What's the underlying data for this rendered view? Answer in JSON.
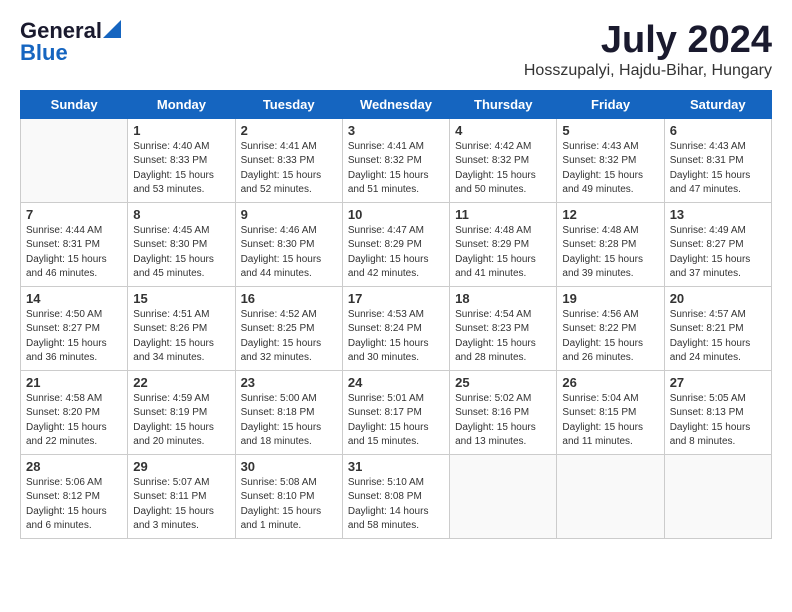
{
  "logo": {
    "general": "General",
    "blue": "Blue"
  },
  "title": "July 2024",
  "subtitle": "Hosszupalyi, Hajdu-Bihar, Hungary",
  "days_header": [
    "Sunday",
    "Monday",
    "Tuesday",
    "Wednesday",
    "Thursday",
    "Friday",
    "Saturday"
  ],
  "weeks": [
    [
      {
        "day": "",
        "info": ""
      },
      {
        "day": "1",
        "info": "Sunrise: 4:40 AM\nSunset: 8:33 PM\nDaylight: 15 hours\nand 53 minutes."
      },
      {
        "day": "2",
        "info": "Sunrise: 4:41 AM\nSunset: 8:33 PM\nDaylight: 15 hours\nand 52 minutes."
      },
      {
        "day": "3",
        "info": "Sunrise: 4:41 AM\nSunset: 8:32 PM\nDaylight: 15 hours\nand 51 minutes."
      },
      {
        "day": "4",
        "info": "Sunrise: 4:42 AM\nSunset: 8:32 PM\nDaylight: 15 hours\nand 50 minutes."
      },
      {
        "day": "5",
        "info": "Sunrise: 4:43 AM\nSunset: 8:32 PM\nDaylight: 15 hours\nand 49 minutes."
      },
      {
        "day": "6",
        "info": "Sunrise: 4:43 AM\nSunset: 8:31 PM\nDaylight: 15 hours\nand 47 minutes."
      }
    ],
    [
      {
        "day": "7",
        "info": "Sunrise: 4:44 AM\nSunset: 8:31 PM\nDaylight: 15 hours\nand 46 minutes."
      },
      {
        "day": "8",
        "info": "Sunrise: 4:45 AM\nSunset: 8:30 PM\nDaylight: 15 hours\nand 45 minutes."
      },
      {
        "day": "9",
        "info": "Sunrise: 4:46 AM\nSunset: 8:30 PM\nDaylight: 15 hours\nand 44 minutes."
      },
      {
        "day": "10",
        "info": "Sunrise: 4:47 AM\nSunset: 8:29 PM\nDaylight: 15 hours\nand 42 minutes."
      },
      {
        "day": "11",
        "info": "Sunrise: 4:48 AM\nSunset: 8:29 PM\nDaylight: 15 hours\nand 41 minutes."
      },
      {
        "day": "12",
        "info": "Sunrise: 4:48 AM\nSunset: 8:28 PM\nDaylight: 15 hours\nand 39 minutes."
      },
      {
        "day": "13",
        "info": "Sunrise: 4:49 AM\nSunset: 8:27 PM\nDaylight: 15 hours\nand 37 minutes."
      }
    ],
    [
      {
        "day": "14",
        "info": "Sunrise: 4:50 AM\nSunset: 8:27 PM\nDaylight: 15 hours\nand 36 minutes."
      },
      {
        "day": "15",
        "info": "Sunrise: 4:51 AM\nSunset: 8:26 PM\nDaylight: 15 hours\nand 34 minutes."
      },
      {
        "day": "16",
        "info": "Sunrise: 4:52 AM\nSunset: 8:25 PM\nDaylight: 15 hours\nand 32 minutes."
      },
      {
        "day": "17",
        "info": "Sunrise: 4:53 AM\nSunset: 8:24 PM\nDaylight: 15 hours\nand 30 minutes."
      },
      {
        "day": "18",
        "info": "Sunrise: 4:54 AM\nSunset: 8:23 PM\nDaylight: 15 hours\nand 28 minutes."
      },
      {
        "day": "19",
        "info": "Sunrise: 4:56 AM\nSunset: 8:22 PM\nDaylight: 15 hours\nand 26 minutes."
      },
      {
        "day": "20",
        "info": "Sunrise: 4:57 AM\nSunset: 8:21 PM\nDaylight: 15 hours\nand 24 minutes."
      }
    ],
    [
      {
        "day": "21",
        "info": "Sunrise: 4:58 AM\nSunset: 8:20 PM\nDaylight: 15 hours\nand 22 minutes."
      },
      {
        "day": "22",
        "info": "Sunrise: 4:59 AM\nSunset: 8:19 PM\nDaylight: 15 hours\nand 20 minutes."
      },
      {
        "day": "23",
        "info": "Sunrise: 5:00 AM\nSunset: 8:18 PM\nDaylight: 15 hours\nand 18 minutes."
      },
      {
        "day": "24",
        "info": "Sunrise: 5:01 AM\nSunset: 8:17 PM\nDaylight: 15 hours\nand 15 minutes."
      },
      {
        "day": "25",
        "info": "Sunrise: 5:02 AM\nSunset: 8:16 PM\nDaylight: 15 hours\nand 13 minutes."
      },
      {
        "day": "26",
        "info": "Sunrise: 5:04 AM\nSunset: 8:15 PM\nDaylight: 15 hours\nand 11 minutes."
      },
      {
        "day": "27",
        "info": "Sunrise: 5:05 AM\nSunset: 8:13 PM\nDaylight: 15 hours\nand 8 minutes."
      }
    ],
    [
      {
        "day": "28",
        "info": "Sunrise: 5:06 AM\nSunset: 8:12 PM\nDaylight: 15 hours\nand 6 minutes."
      },
      {
        "day": "29",
        "info": "Sunrise: 5:07 AM\nSunset: 8:11 PM\nDaylight: 15 hours\nand 3 minutes."
      },
      {
        "day": "30",
        "info": "Sunrise: 5:08 AM\nSunset: 8:10 PM\nDaylight: 15 hours\nand 1 minute."
      },
      {
        "day": "31",
        "info": "Sunrise: 5:10 AM\nSunset: 8:08 PM\nDaylight: 14 hours\nand 58 minutes."
      },
      {
        "day": "",
        "info": ""
      },
      {
        "day": "",
        "info": ""
      },
      {
        "day": "",
        "info": ""
      }
    ]
  ]
}
